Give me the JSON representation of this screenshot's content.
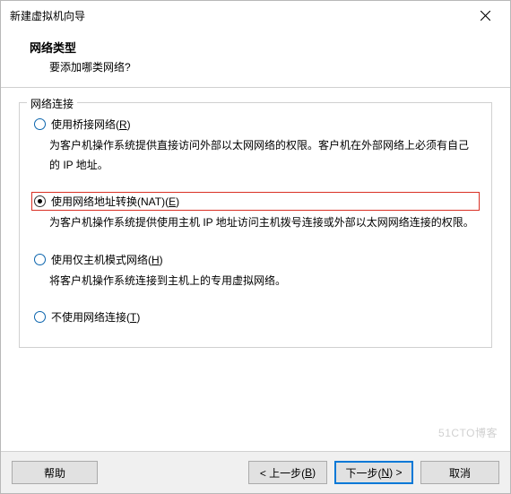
{
  "window": {
    "title": "新建虚拟机向导",
    "close_icon": "×"
  },
  "header": {
    "title": "网络类型",
    "subtitle": "要添加哪类网络?"
  },
  "fieldset": {
    "legend": "网络连接"
  },
  "options": {
    "bridge": {
      "label_pre": "使用桥接网络(",
      "label_accel": "R",
      "label_post": ")",
      "desc": "为客户机操作系统提供直接访问外部以太网网络的权限。客户机在外部网络上必须有自己的 IP 地址。"
    },
    "nat": {
      "label_pre": "使用网络地址转换(NAT)(",
      "label_accel": "E",
      "label_post": ")",
      "desc": "为客户机操作系统提供使用主机 IP 地址访问主机拨号连接或外部以太网网络连接的权限。"
    },
    "hostonly": {
      "label_pre": "使用仅主机模式网络(",
      "label_accel": "H",
      "label_post": ")",
      "desc": "将客户机操作系统连接到主机上的专用虚拟网络。"
    },
    "none": {
      "label_pre": "不使用网络连接(",
      "label_accel": "T",
      "label_post": ")"
    }
  },
  "footer": {
    "help": "帮助",
    "back_pre": "< 上一步(",
    "back_accel": "B",
    "back_post": ")",
    "next_pre": "下一步(",
    "next_accel": "N",
    "next_post": ") >",
    "cancel": "取消"
  },
  "watermark": "51CTO博客"
}
